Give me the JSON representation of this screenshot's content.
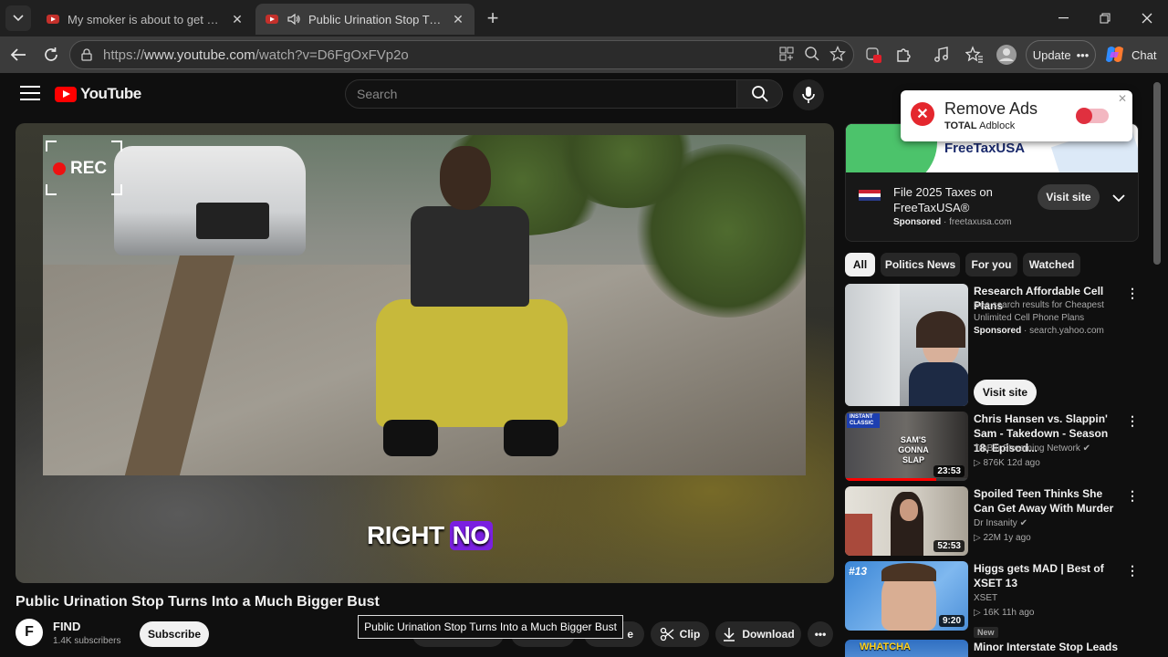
{
  "browser": {
    "tabs": [
      {
        "title": "My smoker is about to get active.",
        "active": false
      },
      {
        "title": "Public Urination Stop Turns Into",
        "active": true
      }
    ],
    "url_prefix": "https://",
    "url_host": "www.youtube.com",
    "url_path": "/watch?v=D6FgOxFVp2o",
    "update_label": "Update",
    "chat_label": "Chat"
  },
  "youtube": {
    "logo_text": "YouTube",
    "search_placeholder": "Search",
    "video": {
      "overlay_rec": "REC",
      "caption_word1": "RIGHT",
      "caption_word2": "NO",
      "title": "Public Urination Stop Turns Into a Much Bigger Bust",
      "tooltip": "Public Urination Stop Turns Into a Much Bigger Bust"
    },
    "channel": {
      "initial": "F",
      "name": "FIND",
      "subscribers": "1.4K subscribers",
      "subscribe_label": "Subscribe"
    },
    "actions": {
      "share_partial": "e",
      "clip": "Clip",
      "download": "Download"
    },
    "ad": {
      "brand": "FreeTaxUSA",
      "title": "File 2025 Taxes on FreeTaxUSA®",
      "sponsored": "Sponsored",
      "domain": "freetaxusa.com",
      "visit_label": "Visit site"
    },
    "popup": {
      "title": "Remove Ads",
      "brand_bold": "TOTAL",
      "brand_rest": "Adblock"
    },
    "chips": [
      "All",
      "Politics News",
      "For you",
      "Watched"
    ],
    "recommendations": [
      {
        "title": "Research Affordable Cell Plans",
        "line1": "See search results for Cheapest",
        "line2": "Unlimited Cell Phone Plans",
        "sponsored": "Sponsored",
        "domain": "search.yahoo.com",
        "visit_label": "Visit site"
      },
      {
        "title": "Chris Hansen vs. Slappin' Sam - Takedown - Season 18, Episod...",
        "channel": "TruBlu Streaming Network",
        "stats": "▷ 876K   12d ago",
        "duration": "23:53",
        "badge": "INSTANT CLASSIC",
        "thumb_text": "SAM'S GONNA SLAP"
      },
      {
        "title": "Spoiled Teen Thinks She Can Get Away With Murder",
        "channel": "Dr Insanity",
        "stats": "▷ 22M   1y ago",
        "duration": "52:53"
      },
      {
        "title": "Higgs gets MAD | Best of XSET 13",
        "channel": "XSET",
        "stats": "▷ 16K   11h ago",
        "duration": "9:20",
        "badge": "New",
        "thumb_text": "#13"
      },
      {
        "title": "Minor Interstate Stop Leads to a",
        "thumb_text": "WHATCHA"
      }
    ]
  }
}
